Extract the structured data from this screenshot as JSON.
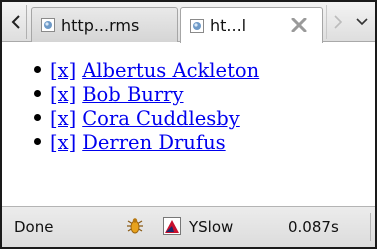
{
  "tabbar": {
    "tabs": [
      {
        "title": "http...rms",
        "active": false
      },
      {
        "title": "ht...l",
        "active": true
      }
    ],
    "scroll_left_icon": "chevron-left-icon",
    "scroll_right_icon": "chevron-right-icon",
    "all_tabs_icon": "chevron-down-icon",
    "close_tab_icon": "close-icon"
  },
  "page": {
    "items": [
      {
        "remove_label": "[x]",
        "name": "Albertus Ackleton"
      },
      {
        "remove_label": "[x]",
        "name": "Bob Burry"
      },
      {
        "remove_label": "[x]",
        "name": "Cora Cuddlesby"
      },
      {
        "remove_label": "[x]",
        "name": "Derren Drufus"
      }
    ],
    "link_color": "#0000ee"
  },
  "statusbar": {
    "status": "Done",
    "firebug_icon": "bug-icon",
    "yslow_icon": "yslow-icon",
    "yslow_label": "YSlow",
    "load_time": "0.087s"
  }
}
